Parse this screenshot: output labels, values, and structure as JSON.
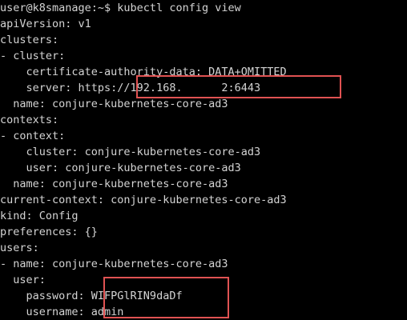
{
  "terminal": {
    "colors": {
      "background": "#000000",
      "text": "#d4d4d4",
      "highlight_border": "#e05252"
    },
    "lines": [
      {
        "text": "user@k8smanage:~$ kubectl config view"
      },
      {
        "text": "apiVersion: v1"
      },
      {
        "text": "clusters:"
      },
      {
        "text": "- cluster:"
      },
      {
        "text": "    certificate-authority-data: DATA+OMITTED"
      },
      {
        "text": "    server: https://192.168.      2:6443"
      },
      {
        "text": "  name: conjure-kubernetes-core-ad3"
      },
      {
        "text": "contexts:"
      },
      {
        "text": "- context:"
      },
      {
        "text": "    cluster: conjure-kubernetes-core-ad3"
      },
      {
        "text": "    user: conjure-kubernetes-core-ad3"
      },
      {
        "text": "  name: conjure-kubernetes-core-ad3"
      },
      {
        "text": "current-context: conjure-kubernetes-core-ad3"
      },
      {
        "text": "kind: Config"
      },
      {
        "text": "preferences: {}"
      },
      {
        "text": "users:"
      },
      {
        "text": "- name: conjure-kubernetes-core-ad3"
      },
      {
        "text": "  user:"
      },
      {
        "text": "    password: WIFPGlRIN9daDf"
      },
      {
        "text": "    username: admin"
      }
    ]
  }
}
